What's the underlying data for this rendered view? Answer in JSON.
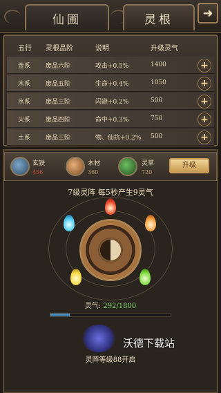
{
  "tabs": [
    {
      "label": "仙圃"
    },
    {
      "label": "灵根"
    }
  ],
  "table": {
    "headers": {
      "element": "五行",
      "grade": "灵根品阶",
      "desc": "说明",
      "cost": "升级灵气"
    },
    "rows": [
      {
        "element": "金系",
        "grade": "废品六阶",
        "desc": "攻击+0.5%",
        "cost": "1400"
      },
      {
        "element": "木系",
        "grade": "废品五阶",
        "desc": "生命+0.4%",
        "cost": "1050"
      },
      {
        "element": "水系",
        "grade": "废品三阶",
        "desc": "闪避+0.2%",
        "cost": "500"
      },
      {
        "element": "火系",
        "grade": "废品四阶",
        "desc": "命中+0.3%",
        "cost": "750"
      },
      {
        "element": "土系",
        "grade": "废品三阶",
        "desc": "物、仙抗+0.2%",
        "cost": "500"
      }
    ]
  },
  "materials": {
    "items": [
      {
        "name": "玄铁",
        "count": "456",
        "icon": "iron-ingot-icon"
      },
      {
        "name": "木材",
        "count": "360",
        "icon": "wood-logs-icon"
      },
      {
        "name": "灵草",
        "count": "720",
        "icon": "spirit-herb-icon"
      }
    ],
    "upgrade_label": "升级"
  },
  "array": {
    "title": "7级灵阵 每5秒产生9灵气"
  },
  "qi": {
    "label": "灵气:",
    "value": "292/1800",
    "progress_fraction": 0.162
  },
  "locked": {
    "text": "灵阵等级88开启"
  },
  "watermark": "沃德下载站"
}
